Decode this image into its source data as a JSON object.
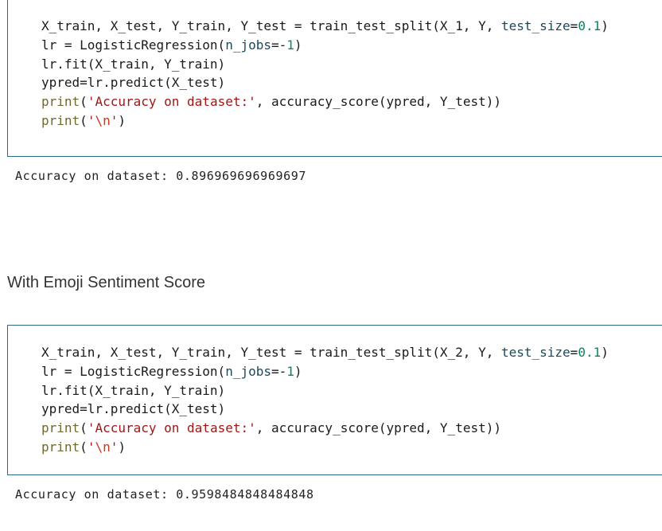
{
  "cells": [
    {
      "lines": [
        [
          {
            "t": "X_train, X_test, Y_train, Y_test = train_test_split(X_1, Y, ",
            "c": "plain"
          },
          {
            "t": "test_size",
            "c": "kw"
          },
          {
            "t": "=",
            "c": "plain"
          },
          {
            "t": "0.1",
            "c": "num"
          },
          {
            "t": ")",
            "c": "plain"
          }
        ],
        [
          {
            "t": "lr = LogisticRegression(",
            "c": "plain"
          },
          {
            "t": "n_jobs",
            "c": "kw"
          },
          {
            "t": "=-",
            "c": "plain"
          },
          {
            "t": "1",
            "c": "num"
          },
          {
            "t": ")",
            "c": "plain"
          }
        ],
        [
          {
            "t": "lr.fit(X_train, Y_train)",
            "c": "plain"
          }
        ],
        [
          {
            "t": "ypred=lr.predict(X_test)",
            "c": "plain"
          }
        ],
        [
          {
            "t": "print",
            "c": "fn"
          },
          {
            "t": "(",
            "c": "plain"
          },
          {
            "t": "'Accuracy on dataset:'",
            "c": "str"
          },
          {
            "t": ", accuracy_score(ypred, Y_test))",
            "c": "plain"
          }
        ],
        [
          {
            "t": "print",
            "c": "fn"
          },
          {
            "t": "(",
            "c": "plain"
          },
          {
            "t": "'",
            "c": "str"
          },
          {
            "t": "\\n",
            "c": "esc"
          },
          {
            "t": "'",
            "c": "str"
          },
          {
            "t": ")",
            "c": "plain"
          }
        ]
      ],
      "output": "Accuracy on dataset: 0.896969696969697"
    },
    {
      "lines": [
        [
          {
            "t": "X_train, X_test, Y_train, Y_test = train_test_split(X_2, Y, ",
            "c": "plain"
          },
          {
            "t": "test_size",
            "c": "kw"
          },
          {
            "t": "=",
            "c": "plain"
          },
          {
            "t": "0.1",
            "c": "num"
          },
          {
            "t": ")",
            "c": "plain"
          }
        ],
        [
          {
            "t": "lr = LogisticRegression(",
            "c": "plain"
          },
          {
            "t": "n_jobs",
            "c": "kw"
          },
          {
            "t": "=-",
            "c": "plain"
          },
          {
            "t": "1",
            "c": "num"
          },
          {
            "t": ")",
            "c": "plain"
          }
        ],
        [
          {
            "t": "lr.fit(X_train, Y_train)",
            "c": "plain"
          }
        ],
        [
          {
            "t": "ypred=lr.predict(X_test)",
            "c": "plain"
          }
        ],
        [
          {
            "t": "print",
            "c": "fn"
          },
          {
            "t": "(",
            "c": "plain"
          },
          {
            "t": "'Accuracy on dataset:'",
            "c": "str"
          },
          {
            "t": ", accuracy_score(ypred, Y_test))",
            "c": "plain"
          }
        ],
        [
          {
            "t": "print",
            "c": "fn"
          },
          {
            "t": "(",
            "c": "plain"
          },
          {
            "t": "'",
            "c": "str"
          },
          {
            "t": "\\n",
            "c": "esc"
          },
          {
            "t": "'",
            "c": "str"
          },
          {
            "t": ")",
            "c": "plain"
          }
        ]
      ],
      "output": "Accuracy on dataset: 0.9598484848484848"
    }
  ],
  "markdown": {
    "heading": "With Emoji Sentiment Score"
  },
  "colors": {
    "cell_border": "#2f6b84",
    "keyword_arg": "#174a5c",
    "number": "#098658",
    "builtin": "#6f6a2f",
    "string": "#a31515"
  }
}
